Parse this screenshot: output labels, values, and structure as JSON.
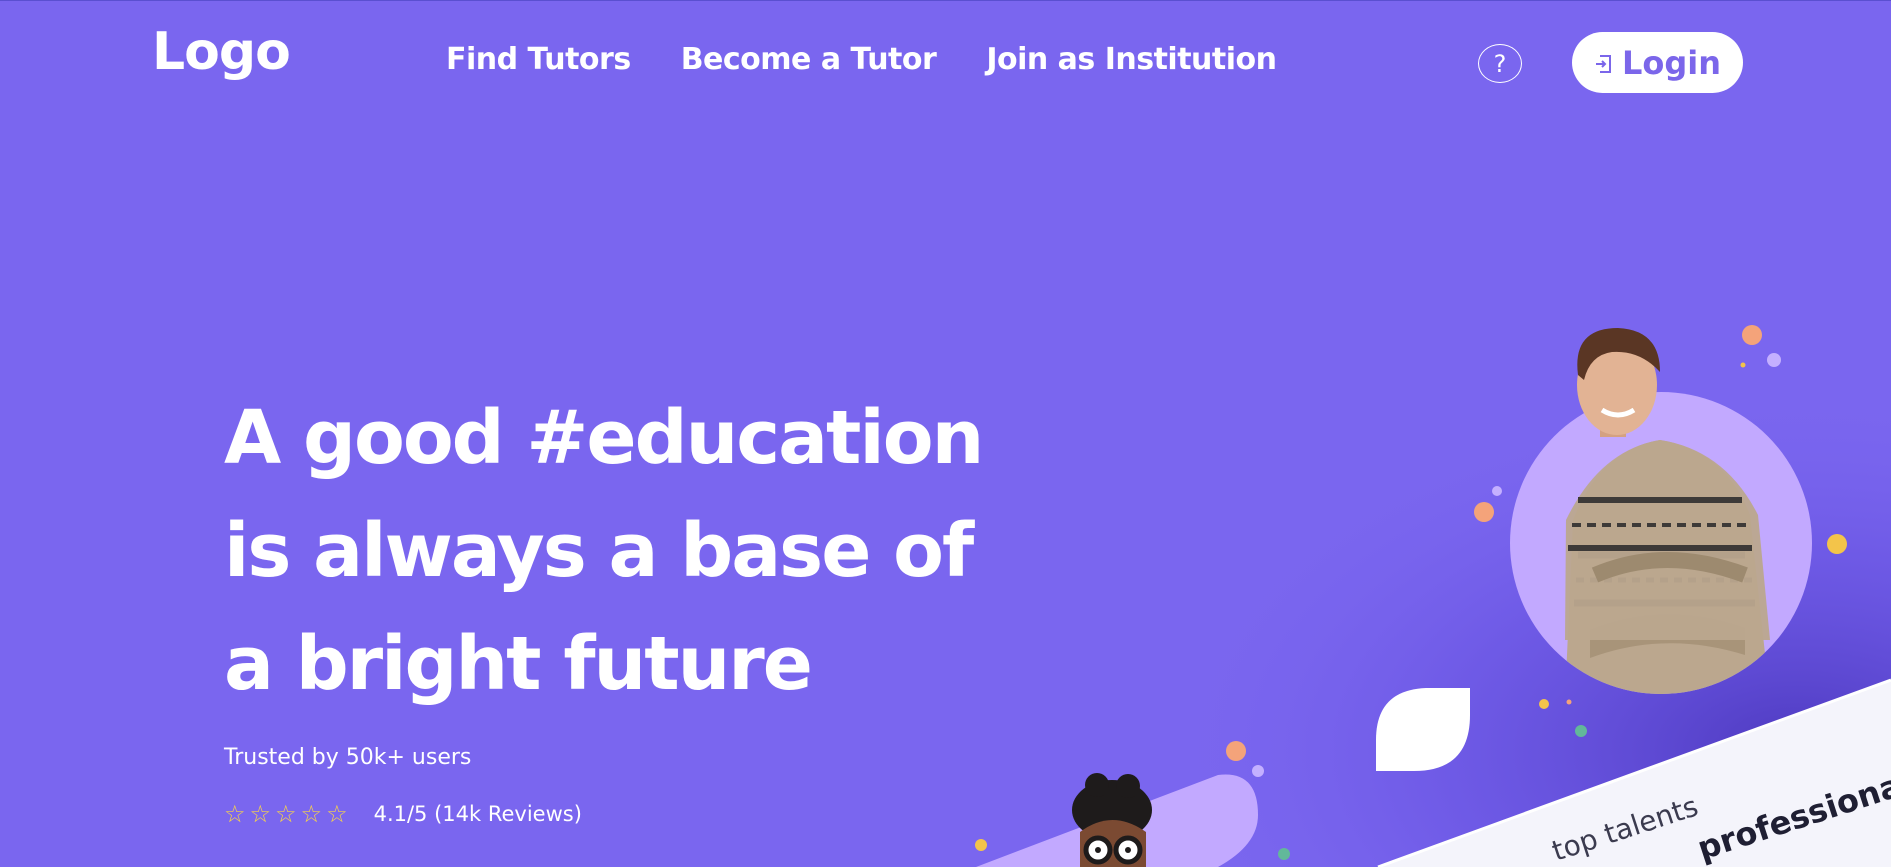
{
  "header": {
    "logo": "Logo",
    "nav": [
      {
        "label": "Find Tutors"
      },
      {
        "label": "Become a Tutor"
      },
      {
        "label": "Join as Institution"
      }
    ],
    "help_icon": "question-circle-icon",
    "help_glyph": "?",
    "login_label": "Login",
    "login_icon": "login-arrow-icon"
  },
  "hero": {
    "title_line1": "A good #education",
    "title_line2": "is always a base of",
    "title_line3": "a bright future",
    "trusted": "Trusted by 50k+ users",
    "rating": {
      "value": 4.1,
      "max": 5,
      "stars_filled": 0
    },
    "rating_text": "4.1/5 (14k Reviews)",
    "card_text_1": "top talents",
    "card_text_2": "professiona"
  },
  "colors": {
    "background": "#7a66ef",
    "accent_purple": "#c2a9ff",
    "star": "#f7d34a",
    "orange_dot": "#f4a37a",
    "yellow_dot": "#f3c44a",
    "green_dot": "#62b89a"
  }
}
